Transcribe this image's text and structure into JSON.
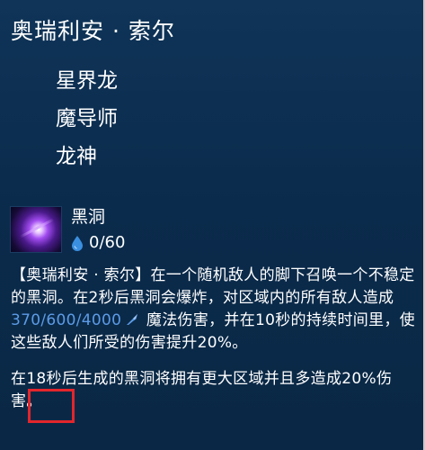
{
  "champion": {
    "name": "奥瑞利安 · 索尔",
    "traits": [
      "星界龙",
      "魔导师",
      "龙神"
    ]
  },
  "ability": {
    "icon": "black-hole-icon",
    "name": "黑洞",
    "mana": "0/60",
    "mana_icon": "water-drop-icon",
    "description": {
      "p1_prefix": "【奥瑞利安 · 索尔】在一个随机敌人的脚下召唤一个不稳定的黑洞。在2秒后黑洞会爆炸，对区域内的所有敌人造成",
      "p1_damage": "370/600/4000",
      "p1_suffix": " 魔法伤害，并在10秒的持续时间里，使这些敌人们所受的伤害提升20%。",
      "p2_prefix": "在",
      "p2_highlight": "18秒",
      "p2_suffix": "后生成的黑洞将拥有更大区域并且多造成20%伤害。"
    }
  },
  "colors": {
    "background": "#0b2a4a",
    "damage_stat": "#5c9be6",
    "highlight_border": "#e3262c",
    "mana_drop": "#3b8fe0"
  }
}
